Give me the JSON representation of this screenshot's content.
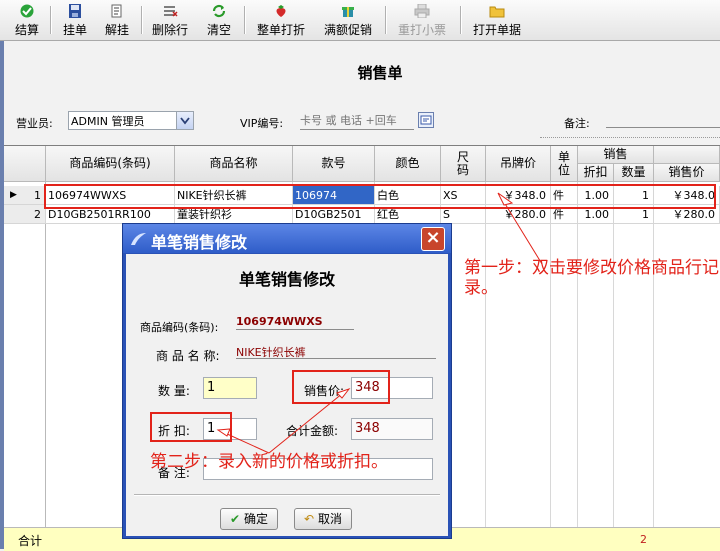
{
  "toolbar": {
    "items": [
      {
        "label": "结算",
        "icon": "check-icon"
      },
      {
        "label": "挂单",
        "icon": "save-icon"
      },
      {
        "label": "解挂",
        "icon": "unlink-icon"
      },
      {
        "label": "删除行",
        "icon": "delete-row-icon"
      },
      {
        "label": "清空",
        "icon": "refresh-icon"
      },
      {
        "label": "整单打折",
        "icon": "strawberry-icon"
      },
      {
        "label": "满额促销",
        "icon": "gift-icon"
      },
      {
        "label": "重打小票",
        "icon": "printer-icon",
        "disabled": true
      },
      {
        "label": "打开单据",
        "icon": "folder-icon"
      }
    ]
  },
  "page": {
    "title": "销售单"
  },
  "form": {
    "salesperson_label": "营业员:",
    "salesperson_value": "ADMIN 管理员",
    "vip_label": "VIP编号:",
    "vip_placeholder": "卡号 或 电话 +回车",
    "remark_label": "备注:"
  },
  "grid": {
    "headers": {
      "code": "商品编码(条码)",
      "name": "商品名称",
      "style": "款号",
      "color": "颜色",
      "size": "尺\n码",
      "tag_price": "吊牌价",
      "unit": "单\n位",
      "sale_group": "销售",
      "discount": "折扣",
      "qty": "数量",
      "sale_price": "销售价"
    },
    "rows": [
      {
        "n": "1",
        "code": "106974WWXS",
        "name": "NIKE针织长裤",
        "style": "106974",
        "color": "白色",
        "size": "XS",
        "tag_price": "￥348.0",
        "unit": "件",
        "discount": "1.00",
        "qty": "1",
        "sale_price": "￥348.0"
      },
      {
        "n": "2",
        "code": "D10GB2501RR100",
        "name": "童装针织衫",
        "style": "D10GB2501",
        "color": "红色",
        "size": "S",
        "tag_price": "￥280.0",
        "unit": "件",
        "discount": "1.00",
        "qty": "1",
        "sale_price": "￥280.0"
      }
    ],
    "footer_label": "合计",
    "footer_qty": "2"
  },
  "dialog": {
    "title_bar": "单笔销售修改",
    "heading": "单笔销售修改",
    "code_label": "商品编码(条码):",
    "code_value": "106974WWXS",
    "name_label": "商 品 名 称:",
    "name_value": "NIKE针织长裤",
    "qty_label": "数 量:",
    "qty_value": "1",
    "price_label": "销售价:",
    "price_value": "348",
    "discount_label": "折 扣:",
    "discount_value": "1",
    "total_label": "合计金额:",
    "total_value": "348",
    "remark_label": "备 注:",
    "ok_label": "确定",
    "cancel_label": "取消"
  },
  "annotations": {
    "step1": "第一步：双击要修改价格商品行记录。",
    "step2": "第二步：录入新的价格或折扣。"
  },
  "colors": {
    "accent_red": "#e2231a",
    "dialog_blue": "#2a52b6",
    "footer_yellow": "#ffffc0"
  }
}
